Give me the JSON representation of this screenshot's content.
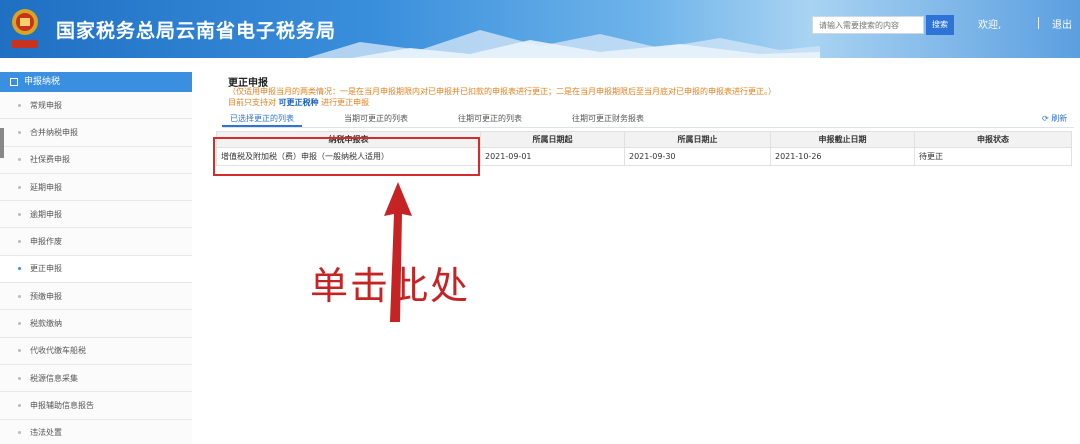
{
  "header": {
    "site_title": "国家税务总局云南省电子税务局",
    "search_placeholder": "请输入需要搜索的内容",
    "search_button": "搜索",
    "welcome": "欢迎,",
    "logout": "退出",
    "emblem_text": "税务总局"
  },
  "sidebar": {
    "section_title": "申报纳税",
    "items": [
      {
        "label": "常规申报"
      },
      {
        "label": "合并纳税申报"
      },
      {
        "label": "社保费申报"
      },
      {
        "label": "延期申报"
      },
      {
        "label": "逾期申报"
      },
      {
        "label": "申报作废"
      },
      {
        "label": "更正申报",
        "active": true
      },
      {
        "label": "预缴申报"
      },
      {
        "label": "税款缴纳"
      },
      {
        "label": "代收代缴车船税"
      },
      {
        "label": "税源信息采集"
      },
      {
        "label": "申报辅助信息报告"
      },
      {
        "label": "违法处置"
      }
    ]
  },
  "main": {
    "title": "更正申报",
    "notice": "（仅适用申报当月的两类情况：一是在当月申报期限内对已申报并已扣款的申报表进行更正；二是在当月申报期限后至当月底对已申报的申报表进行更正。）",
    "notice2_prefix": "目前只支持对",
    "notice2_link": "可更正税种",
    "notice2_suffix": "进行更正申报",
    "tabs": [
      {
        "label": "已选择更正的列表",
        "active": true
      },
      {
        "label": "当期可更正的列表"
      },
      {
        "label": "往期可更正的列表"
      },
      {
        "label": "往期可更正财务报表"
      }
    ],
    "refresh": "刷新",
    "table": {
      "headers": [
        "纳税申报表",
        "所属日期起",
        "所属日期止",
        "申报截止日期",
        "申报状态"
      ],
      "rows": [
        [
          "增值税及附加税（费）申报（一般纳税人适用）",
          "2021-09-01",
          "2021-09-30",
          "2021-10-26",
          "待更正"
        ]
      ]
    },
    "callout": "单击此处"
  },
  "colors": {
    "accent": "#3b8fe0",
    "notice": "#e6801e",
    "annotation": "#d62b2b"
  }
}
